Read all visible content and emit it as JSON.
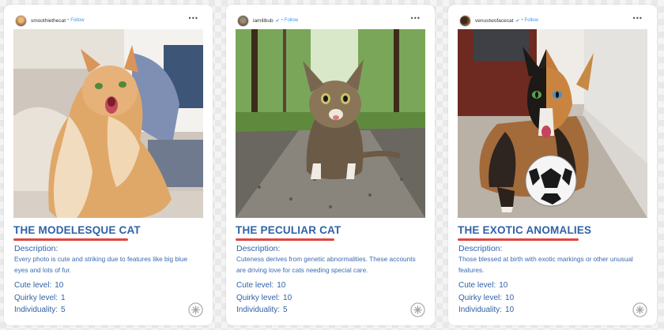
{
  "colors": {
    "title": "#2f62a7",
    "underline": "#e0453f",
    "body_text": "#3a6bb0",
    "follow_link": "#3897f0"
  },
  "cards": [
    {
      "header": {
        "username": "smoothiethecat",
        "follow": "Follow",
        "verified": false,
        "more_icon": "more-horizontal-icon"
      },
      "photo_subject": "fluffy long-haired ginger cat",
      "title": "THE MODELESQUE CAT",
      "description_label": "Description:",
      "description": "Every photo is cute and striking due to features like big blue eyes and lots of fur.",
      "stats": [
        {
          "label": "Cute level:",
          "value": "10"
        },
        {
          "label": "Quirky level:",
          "value": "1"
        },
        {
          "label": "Individuality:",
          "value": "5"
        }
      ],
      "badge_icon": "paw-logo-icon"
    },
    {
      "header": {
        "username": "iamlilbub",
        "follow": "Follow",
        "verified": true,
        "more_icon": "more-horizontal-icon"
      },
      "photo_subject": "tabby cat on gravel path",
      "title": "THE PECULIAR CAT",
      "description_label": "Description:",
      "description": "Cuteness derives from genetic abnormalities. These accounts are driving love for cats needing special care.",
      "stats": [
        {
          "label": "Cute level:",
          "value": "10"
        },
        {
          "label": "Quirky level:",
          "value": "10"
        },
        {
          "label": "Individuality:",
          "value": "5"
        }
      ],
      "badge_icon": "paw-logo-icon"
    },
    {
      "header": {
        "username": "venustwofacecat",
        "follow": "Follow",
        "verified": true,
        "more_icon": "more-horizontal-icon"
      },
      "photo_subject": "two-faced cat with soccer ball",
      "title": "THE EXOTIC ANOMALIES",
      "description_label": "Description:",
      "description": "Those blessed at birth with exotic markings or other unusual features.",
      "stats": [
        {
          "label": "Cute level:",
          "value": "10"
        },
        {
          "label": "Quirky level:",
          "value": "10"
        },
        {
          "label": "Individuality:",
          "value": "10"
        }
      ],
      "badge_icon": "paw-logo-icon"
    }
  ]
}
